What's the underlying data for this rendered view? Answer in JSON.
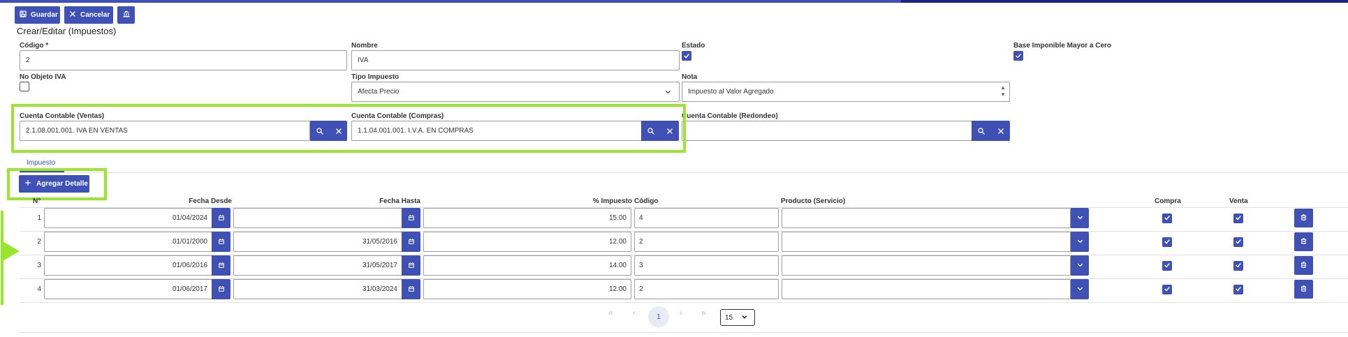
{
  "toolbar": {
    "save_label": "Guardar",
    "cancel_label": "Cancelar"
  },
  "page_title": "Crear/Editar (Impuestos)",
  "form": {
    "codigo_label": "Código",
    "codigo_required": "*",
    "codigo_value": "2",
    "nombre_label": "Nombre",
    "nombre_value": "IVA",
    "estado_label": "Estado",
    "estado_checked": true,
    "base_label": "Base Imponible Mayor a Cero",
    "base_checked": true,
    "no_objeto_label": "No Objeto IVA",
    "no_objeto_checked": false,
    "tipo_label": "Tipo Impuesto",
    "tipo_value": "Afecta Precio",
    "nota_label": "Nota",
    "nota_value": "Impuesto al Valor Agregado",
    "cuenta_ventas_label": "Cuenta Contable (Ventas)",
    "cuenta_ventas_value": "2.1.08.001.001. IVA EN VENTAS",
    "cuenta_compras_label": "Cuenta Contable (Compras)",
    "cuenta_compras_value": "1.1.04.001.001. I.V.A. EN COMPRAS",
    "cuenta_redondeo_label": "Cuenta Contable (Redondeo)",
    "cuenta_redondeo_value": ""
  },
  "tab_label": "Impuesto",
  "add_detail_label": "Agregar Detalle",
  "table": {
    "headers": {
      "num": "N°",
      "fecha_desde": "Fecha Desde",
      "fecha_hasta": "Fecha Hasta",
      "impuesto": "% Impuesto",
      "codigo": "Código",
      "producto": "Producto (Servicio)",
      "compra": "Compra",
      "venta": "Venta"
    },
    "rows": [
      {
        "num": "1",
        "fecha_desde": "01/04/2024",
        "fecha_hasta": "",
        "impuesto": "15.00",
        "codigo": "4",
        "producto": "",
        "compra": true,
        "venta": true
      },
      {
        "num": "2",
        "fecha_desde": "01/01/2000",
        "fecha_hasta": "31/05/2016",
        "impuesto": "12.00",
        "codigo": "2",
        "producto": "",
        "compra": true,
        "venta": true
      },
      {
        "num": "3",
        "fecha_desde": "01/06/2016",
        "fecha_hasta": "31/05/2017",
        "impuesto": "14.00",
        "codigo": "3",
        "producto": "",
        "compra": true,
        "venta": true
      },
      {
        "num": "4",
        "fecha_desde": "01/06/2017",
        "fecha_hasta": "31/03/2024",
        "impuesto": "12.00",
        "codigo": "2",
        "producto": "",
        "compra": true,
        "venta": true
      }
    ]
  },
  "pagination": {
    "first": "«",
    "prev": "‹",
    "current_page": "1",
    "next": "›",
    "last": "»",
    "page_size": "15"
  },
  "colors": {
    "primary": "#3f51b5",
    "highlight": "#9ae62e"
  }
}
